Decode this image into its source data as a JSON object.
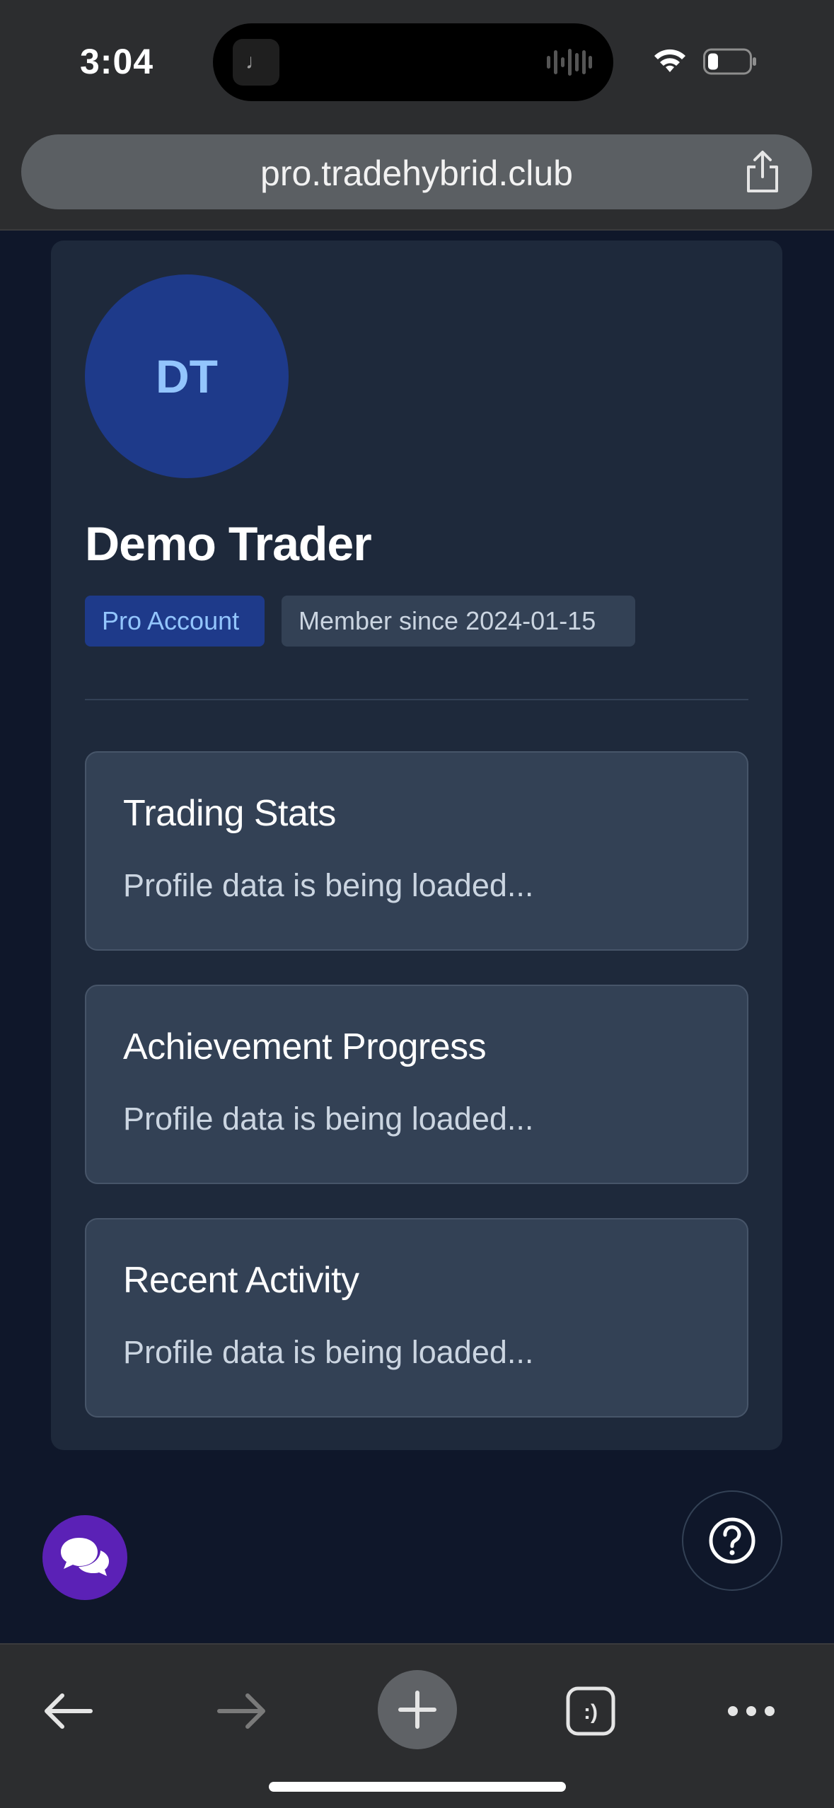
{
  "status_bar": {
    "time": "3:04",
    "island_app_glyph": "♩"
  },
  "browser": {
    "url": "pro.tradehybrid.club"
  },
  "profile": {
    "initials": "DT",
    "name": "Demo Trader",
    "account_badge": "Pro Account",
    "member_badge": "Member since 2024-01-15"
  },
  "sections": [
    {
      "title": "Trading Stats",
      "body": "Profile data is being loaded..."
    },
    {
      "title": "Achievement Progress",
      "body": "Profile data is being loaded..."
    },
    {
      "title": "Recent Activity",
      "body": "Profile data is being loaded..."
    }
  ],
  "toolbar": {
    "tabs_label": ":)"
  },
  "colors": {
    "page_bg": "#0f172a",
    "card_bg": "#1e293b",
    "section_bg": "#334155",
    "accent_blue": "#1e3a8a",
    "chat_purple": "#5b21b6"
  },
  "icons": [
    "wifi-icon",
    "battery-icon",
    "share-icon",
    "chat-bubbles-icon",
    "help-icon",
    "back-arrow-icon",
    "forward-arrow-icon",
    "plus-icon",
    "tabs-icon",
    "more-icon"
  ]
}
